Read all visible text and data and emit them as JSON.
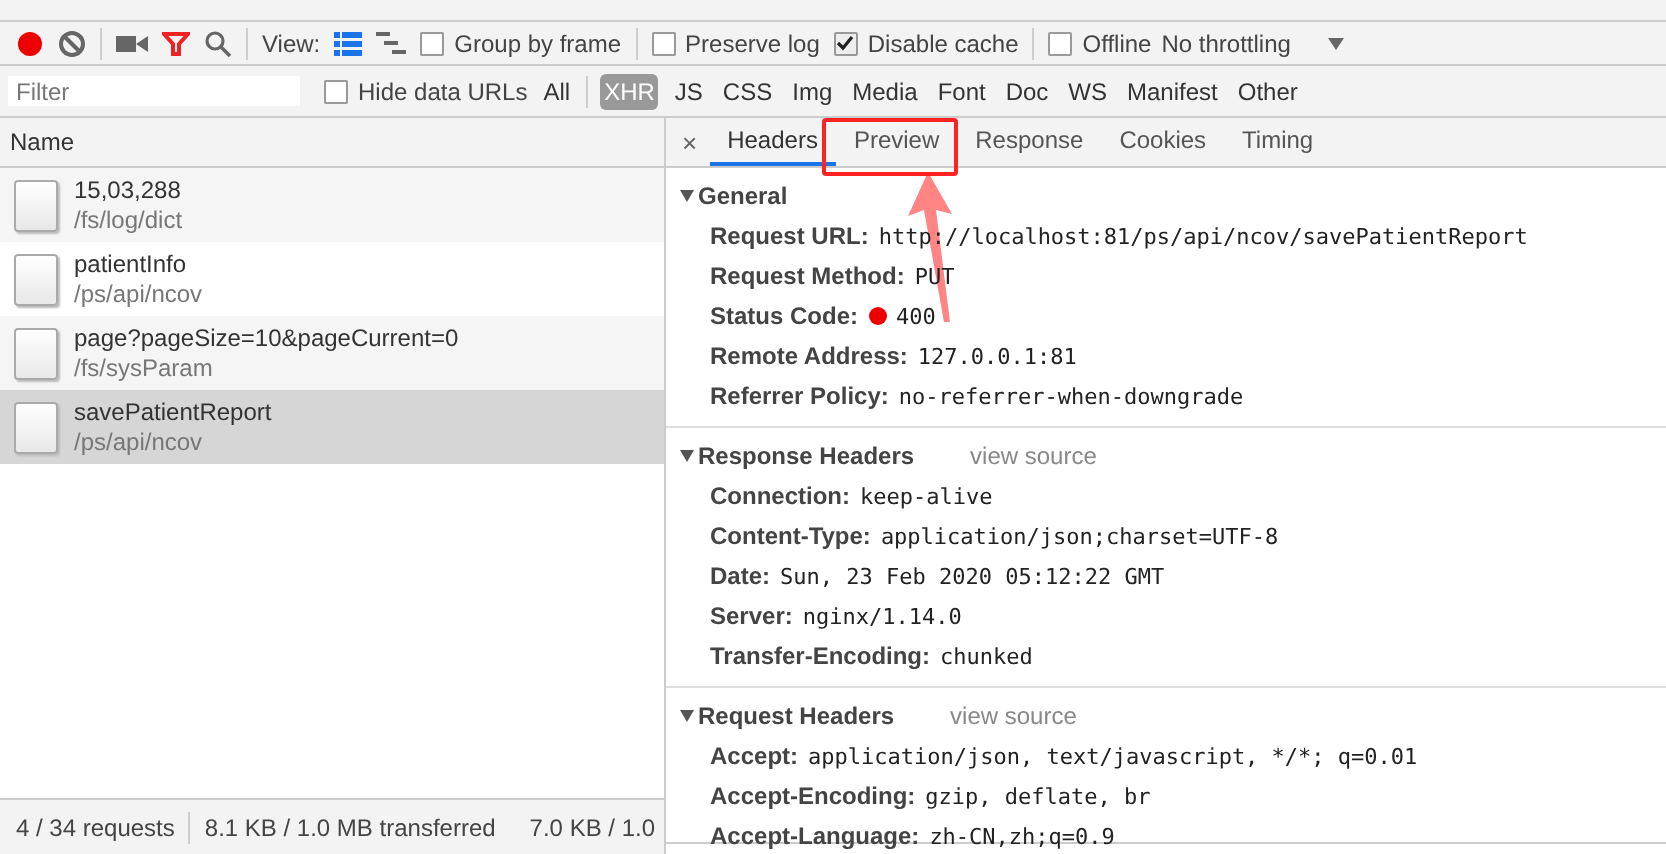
{
  "toolbar": {
    "recording": true,
    "filter_on": true,
    "view_label": "View:",
    "view_modes": [
      {
        "kind": "list",
        "selected": true
      },
      {
        "kind": "waterfall",
        "selected": false
      }
    ],
    "checkboxes": [
      {
        "label": "Group by frame",
        "checked": false
      },
      {
        "label": "Preserve log",
        "checked": false
      },
      {
        "label": "Disable cache",
        "checked": true
      },
      {
        "label": "Offline",
        "checked": false
      }
    ],
    "throttling": "No throttling"
  },
  "filter_bar": {
    "placeholder": "Filter",
    "hide_data_urls": {
      "label": "Hide data URLs",
      "checked": false
    },
    "types": [
      {
        "label": "All",
        "selected": false
      },
      {
        "label": "XHR",
        "selected": true
      },
      {
        "label": "JS",
        "selected": false
      },
      {
        "label": "CSS",
        "selected": false
      },
      {
        "label": "Img",
        "selected": false
      },
      {
        "label": "Media",
        "selected": false
      },
      {
        "label": "Font",
        "selected": false
      },
      {
        "label": "Doc",
        "selected": false
      },
      {
        "label": "WS",
        "selected": false
      },
      {
        "label": "Manifest",
        "selected": false
      },
      {
        "label": "Other",
        "selected": false
      }
    ]
  },
  "requests": {
    "column": "Name",
    "rows": [
      {
        "name": "15,03,288",
        "path": "/fs/log/dict",
        "selected": false
      },
      {
        "name": "patientInfo",
        "path": "/ps/api/ncov",
        "selected": false
      },
      {
        "name": "page?pageSize=10&pageCurrent=0",
        "path": "/fs/sysParam",
        "selected": false
      },
      {
        "name": "savePatientReport",
        "path": "/ps/api/ncov",
        "selected": true
      }
    ]
  },
  "status_bar": [
    "4 / 34 requests",
    "8.1 KB / 1.0 MB transferred",
    "7.0 KB / 1.0"
  ],
  "details": {
    "close": "×",
    "tabs": [
      {
        "label": "Headers",
        "selected": true
      },
      {
        "label": "Preview",
        "selected": false
      },
      {
        "label": "Response",
        "selected": false
      },
      {
        "label": "Cookies",
        "selected": false
      },
      {
        "label": "Timing",
        "selected": false
      }
    ],
    "sections": [
      {
        "title": "General",
        "expanded": true,
        "rows": [
          {
            "kind": "plain",
            "key": "Request URL:",
            "value": "http://localhost:81/ps/api/ncov/savePatientReport"
          },
          {
            "kind": "plain",
            "key": "Request Method:",
            "value": "PUT"
          },
          {
            "kind": "status",
            "key": "Status Code:",
            "value": "400"
          },
          {
            "kind": "plain",
            "key": "Remote Address:",
            "value": "127.0.0.1:81"
          },
          {
            "kind": "plain",
            "key": "Referrer Policy:",
            "value": "no-referrer-when-downgrade"
          }
        ]
      },
      {
        "title": "Response Headers",
        "view_source": "view source",
        "expanded": true,
        "rows": [
          {
            "kind": "plain",
            "key": "Connection:",
            "value": "keep-alive"
          },
          {
            "kind": "plain",
            "key": "Content-Type:",
            "value": "application/json;charset=UTF-8"
          },
          {
            "kind": "plain",
            "key": "Date:",
            "value": "Sun, 23 Feb 2020 05:12:22 GMT"
          },
          {
            "kind": "plain",
            "key": "Server:",
            "value": "nginx/1.14.0"
          },
          {
            "kind": "plain",
            "key": "Transfer-Encoding:",
            "value": "chunked"
          }
        ]
      },
      {
        "title": "Request Headers",
        "view_source": "view source",
        "expanded": true,
        "rows": [
          {
            "kind": "plain",
            "key": "Accept:",
            "value": "application/json, text/javascript, */*; q=0.01"
          },
          {
            "kind": "plain",
            "key": "Accept-Encoding:",
            "value": "gzip, deflate, br"
          },
          {
            "kind": "plain",
            "key": "Accept-Language:",
            "value": "zh-CN,zh;q=0.9"
          }
        ]
      }
    ]
  }
}
